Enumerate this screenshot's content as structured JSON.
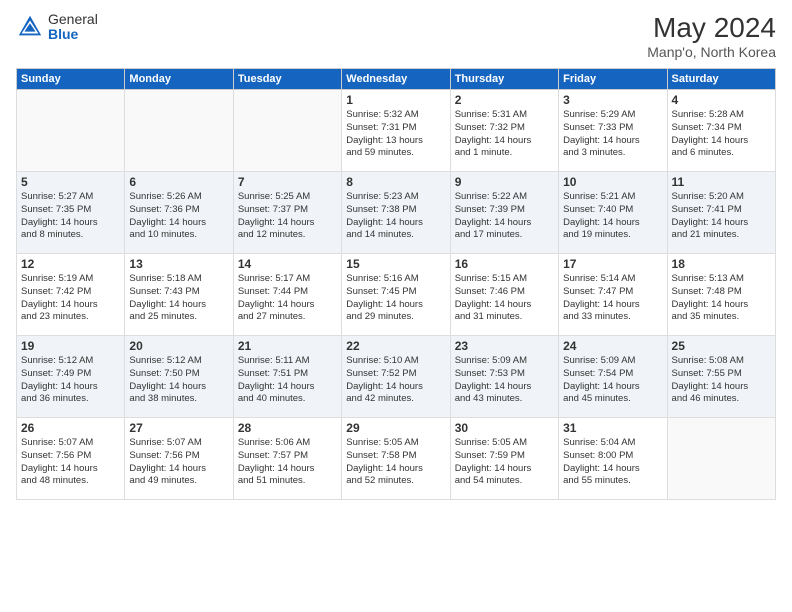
{
  "header": {
    "logo_general": "General",
    "logo_blue": "Blue",
    "title": "May 2024",
    "location": "Manp'o, North Korea"
  },
  "days_of_week": [
    "Sunday",
    "Monday",
    "Tuesday",
    "Wednesday",
    "Thursday",
    "Friday",
    "Saturday"
  ],
  "weeks": [
    [
      {
        "day": "",
        "info": ""
      },
      {
        "day": "",
        "info": ""
      },
      {
        "day": "",
        "info": ""
      },
      {
        "day": "1",
        "info": "Sunrise: 5:32 AM\nSunset: 7:31 PM\nDaylight: 13 hours\nand 59 minutes."
      },
      {
        "day": "2",
        "info": "Sunrise: 5:31 AM\nSunset: 7:32 PM\nDaylight: 14 hours\nand 1 minute."
      },
      {
        "day": "3",
        "info": "Sunrise: 5:29 AM\nSunset: 7:33 PM\nDaylight: 14 hours\nand 3 minutes."
      },
      {
        "day": "4",
        "info": "Sunrise: 5:28 AM\nSunset: 7:34 PM\nDaylight: 14 hours\nand 6 minutes."
      }
    ],
    [
      {
        "day": "5",
        "info": "Sunrise: 5:27 AM\nSunset: 7:35 PM\nDaylight: 14 hours\nand 8 minutes."
      },
      {
        "day": "6",
        "info": "Sunrise: 5:26 AM\nSunset: 7:36 PM\nDaylight: 14 hours\nand 10 minutes."
      },
      {
        "day": "7",
        "info": "Sunrise: 5:25 AM\nSunset: 7:37 PM\nDaylight: 14 hours\nand 12 minutes."
      },
      {
        "day": "8",
        "info": "Sunrise: 5:23 AM\nSunset: 7:38 PM\nDaylight: 14 hours\nand 14 minutes."
      },
      {
        "day": "9",
        "info": "Sunrise: 5:22 AM\nSunset: 7:39 PM\nDaylight: 14 hours\nand 17 minutes."
      },
      {
        "day": "10",
        "info": "Sunrise: 5:21 AM\nSunset: 7:40 PM\nDaylight: 14 hours\nand 19 minutes."
      },
      {
        "day": "11",
        "info": "Sunrise: 5:20 AM\nSunset: 7:41 PM\nDaylight: 14 hours\nand 21 minutes."
      }
    ],
    [
      {
        "day": "12",
        "info": "Sunrise: 5:19 AM\nSunset: 7:42 PM\nDaylight: 14 hours\nand 23 minutes."
      },
      {
        "day": "13",
        "info": "Sunrise: 5:18 AM\nSunset: 7:43 PM\nDaylight: 14 hours\nand 25 minutes."
      },
      {
        "day": "14",
        "info": "Sunrise: 5:17 AM\nSunset: 7:44 PM\nDaylight: 14 hours\nand 27 minutes."
      },
      {
        "day": "15",
        "info": "Sunrise: 5:16 AM\nSunset: 7:45 PM\nDaylight: 14 hours\nand 29 minutes."
      },
      {
        "day": "16",
        "info": "Sunrise: 5:15 AM\nSunset: 7:46 PM\nDaylight: 14 hours\nand 31 minutes."
      },
      {
        "day": "17",
        "info": "Sunrise: 5:14 AM\nSunset: 7:47 PM\nDaylight: 14 hours\nand 33 minutes."
      },
      {
        "day": "18",
        "info": "Sunrise: 5:13 AM\nSunset: 7:48 PM\nDaylight: 14 hours\nand 35 minutes."
      }
    ],
    [
      {
        "day": "19",
        "info": "Sunrise: 5:12 AM\nSunset: 7:49 PM\nDaylight: 14 hours\nand 36 minutes."
      },
      {
        "day": "20",
        "info": "Sunrise: 5:12 AM\nSunset: 7:50 PM\nDaylight: 14 hours\nand 38 minutes."
      },
      {
        "day": "21",
        "info": "Sunrise: 5:11 AM\nSunset: 7:51 PM\nDaylight: 14 hours\nand 40 minutes."
      },
      {
        "day": "22",
        "info": "Sunrise: 5:10 AM\nSunset: 7:52 PM\nDaylight: 14 hours\nand 42 minutes."
      },
      {
        "day": "23",
        "info": "Sunrise: 5:09 AM\nSunset: 7:53 PM\nDaylight: 14 hours\nand 43 minutes."
      },
      {
        "day": "24",
        "info": "Sunrise: 5:09 AM\nSunset: 7:54 PM\nDaylight: 14 hours\nand 45 minutes."
      },
      {
        "day": "25",
        "info": "Sunrise: 5:08 AM\nSunset: 7:55 PM\nDaylight: 14 hours\nand 46 minutes."
      }
    ],
    [
      {
        "day": "26",
        "info": "Sunrise: 5:07 AM\nSunset: 7:56 PM\nDaylight: 14 hours\nand 48 minutes."
      },
      {
        "day": "27",
        "info": "Sunrise: 5:07 AM\nSunset: 7:56 PM\nDaylight: 14 hours\nand 49 minutes."
      },
      {
        "day": "28",
        "info": "Sunrise: 5:06 AM\nSunset: 7:57 PM\nDaylight: 14 hours\nand 51 minutes."
      },
      {
        "day": "29",
        "info": "Sunrise: 5:05 AM\nSunset: 7:58 PM\nDaylight: 14 hours\nand 52 minutes."
      },
      {
        "day": "30",
        "info": "Sunrise: 5:05 AM\nSunset: 7:59 PM\nDaylight: 14 hours\nand 54 minutes."
      },
      {
        "day": "31",
        "info": "Sunrise: 5:04 AM\nSunset: 8:00 PM\nDaylight: 14 hours\nand 55 minutes."
      },
      {
        "day": "",
        "info": ""
      }
    ]
  ]
}
